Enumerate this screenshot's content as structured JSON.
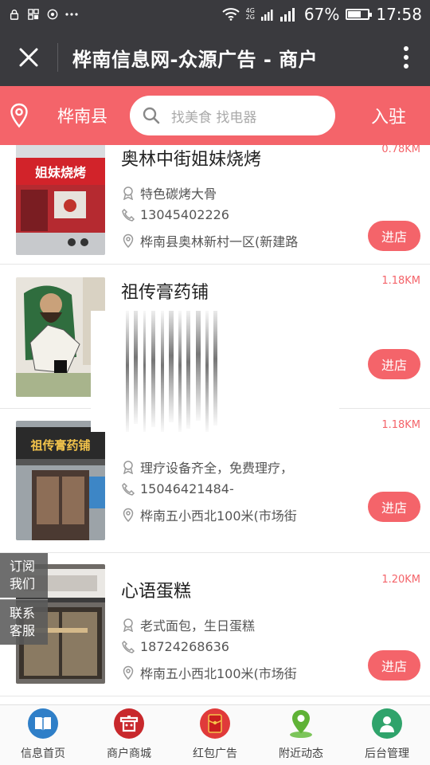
{
  "status": {
    "battery": "67%",
    "time": "17:58",
    "net_top": "4G",
    "net_bottom": "2G",
    "battery_level": 0.67
  },
  "title": {
    "text": "桦南信息网-众源广告 - 商户"
  },
  "search": {
    "city": "桦南县",
    "placeholder": "找美食 找电器",
    "join": "入驻"
  },
  "merchants": [
    {
      "name": "奥林中街姐妹烧烤",
      "distance": "0.78KM",
      "feature": "特色碳烤大骨",
      "phone": "13045402226",
      "address": "桦南县奥林新村一区(新建路",
      "button": "进店",
      "thumb_sign": "姐妹烧烤"
    },
    {
      "name": "祖传膏药铺",
      "distance": "1.18KM",
      "feature": "",
      "phone": "",
      "address": "",
      "button": "进店"
    },
    {
      "name": "",
      "distance": "1.18KM",
      "feature": "理疗设备齐全，免费理疗，",
      "phone": "15046421484-",
      "address": "桦南五小西北100米(市场街",
      "button": "进店",
      "thumb_sign": "祖传膏药铺"
    },
    {
      "name": "心语蛋糕",
      "distance": "1.20KM",
      "feature": "老式面包，生日蛋糕",
      "phone": "18724268636",
      "address": "桦南五小西北100米(市场街",
      "button": "进店"
    }
  ],
  "side_tabs": {
    "subscribe_line1": "订阅",
    "subscribe_line2": "我们",
    "service_line1": "联系",
    "service_line2": "客服"
  },
  "nav": [
    {
      "label": "信息首页",
      "icon": "book-icon",
      "color": "#2f7fc8"
    },
    {
      "label": "商户商城",
      "icon": "shop-icon",
      "color": "#c8282c"
    },
    {
      "label": "红包广告",
      "icon": "red-packet-icon",
      "color": "#e03a3a"
    },
    {
      "label": "附近动态",
      "icon": "location-icon",
      "color": "#5fb236"
    },
    {
      "label": "后台管理",
      "icon": "admin-icon",
      "color": "#2fa36b"
    }
  ],
  "colors": {
    "accent": "#f4646a",
    "header": "#3a3a3e"
  }
}
